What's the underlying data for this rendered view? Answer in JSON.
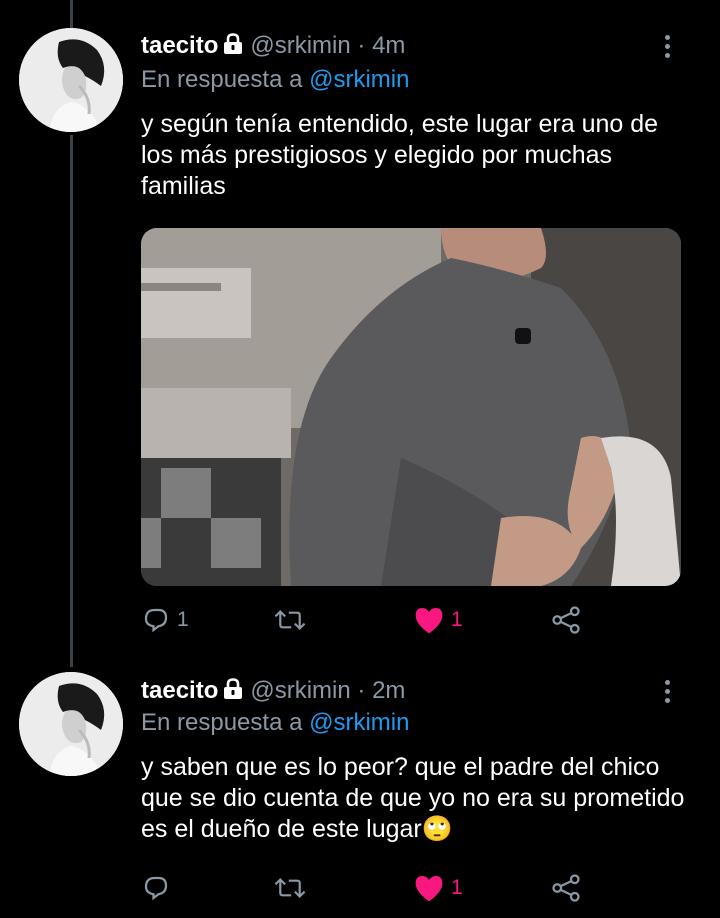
{
  "tweets": [
    {
      "display_name": "taecito",
      "handle": "@srkimin",
      "separator": "·",
      "time": "4m",
      "reply_prefix": "En respuesta a",
      "reply_to": "@srkimin",
      "text": "y según tenía entendido, este lugar era uno de los más prestigiosos y elegido por muchas familias",
      "reply_count": "1",
      "retweet_count": "",
      "like_count": "1",
      "liked": true
    },
    {
      "display_name": "taecito",
      "handle": "@srkimin",
      "separator": "·",
      "time": "2m",
      "reply_prefix": "En respuesta a",
      "reply_to": "@srkimin",
      "text": "y saben que es lo peor? que el padre del chico que se dio cuenta de que yo no era su prometido es el dueño de este lugar🙄",
      "reply_count": "",
      "retweet_count": "",
      "like_count": "1",
      "liked": true
    }
  ],
  "icons": [
    "lock-icon",
    "more-icon",
    "reply-icon",
    "retweet-icon",
    "heart-icon",
    "share-icon"
  ],
  "colors": {
    "background": "#000000",
    "secondary_text": "#8b98a5",
    "link": "#1d9bf0",
    "like": "#f91880",
    "thread_line": "#3d4148"
  }
}
